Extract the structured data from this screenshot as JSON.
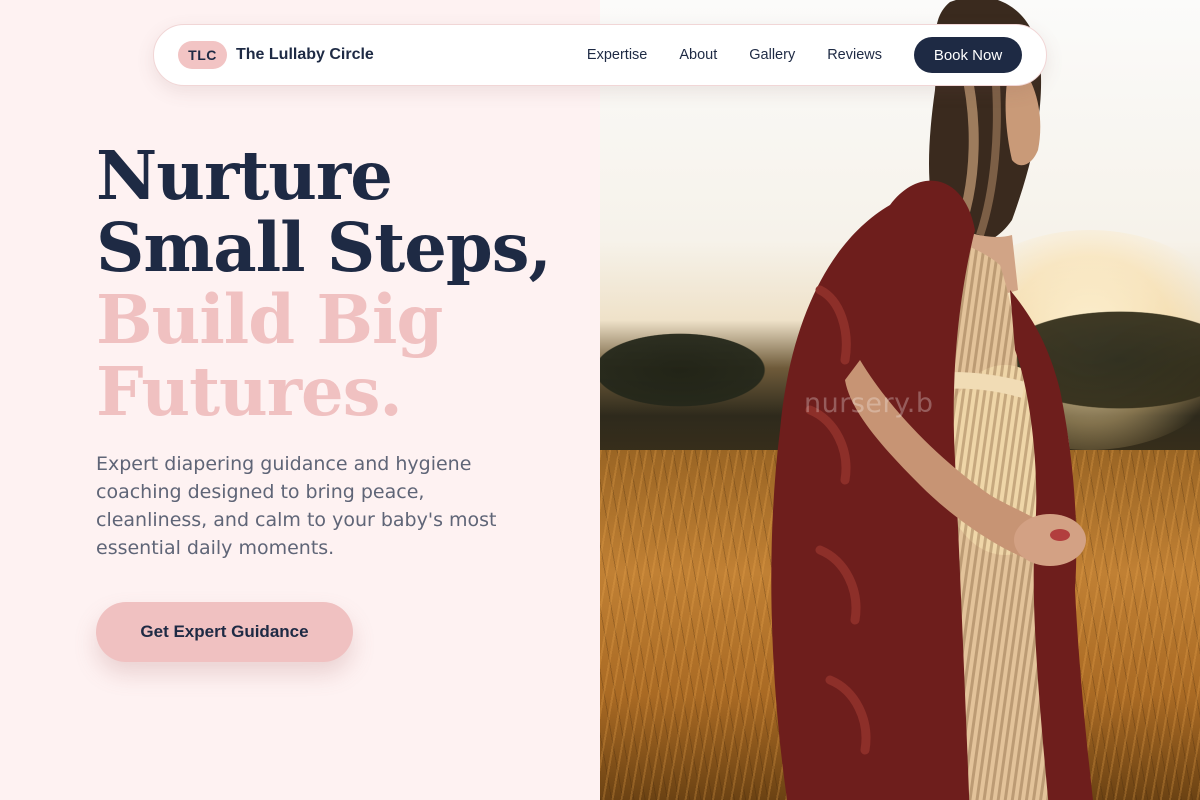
{
  "nav": {
    "logo_badge": "TLC",
    "brand_name": "The Lullaby Circle",
    "links": [
      "Expertise",
      "About",
      "Gallery",
      "Reviews"
    ],
    "cta_label": "Book Now"
  },
  "hero": {
    "title_line1": "Nurture",
    "title_line2": "Small Steps,",
    "title_line3": "Build Big",
    "title_line4": "Futures.",
    "description": "Expert diapering guidance and hygiene coaching designed to bring peace, cleanliness, and calm to your baby's most essential daily moments.",
    "cta_label": "Get Expert Guidance"
  },
  "image": {
    "watermark": "nursery.b"
  },
  "colors": {
    "navy": "#1e2a44",
    "pink": "#f0c1c1",
    "background": "#fef2f2",
    "body_text": "#5f6577"
  }
}
